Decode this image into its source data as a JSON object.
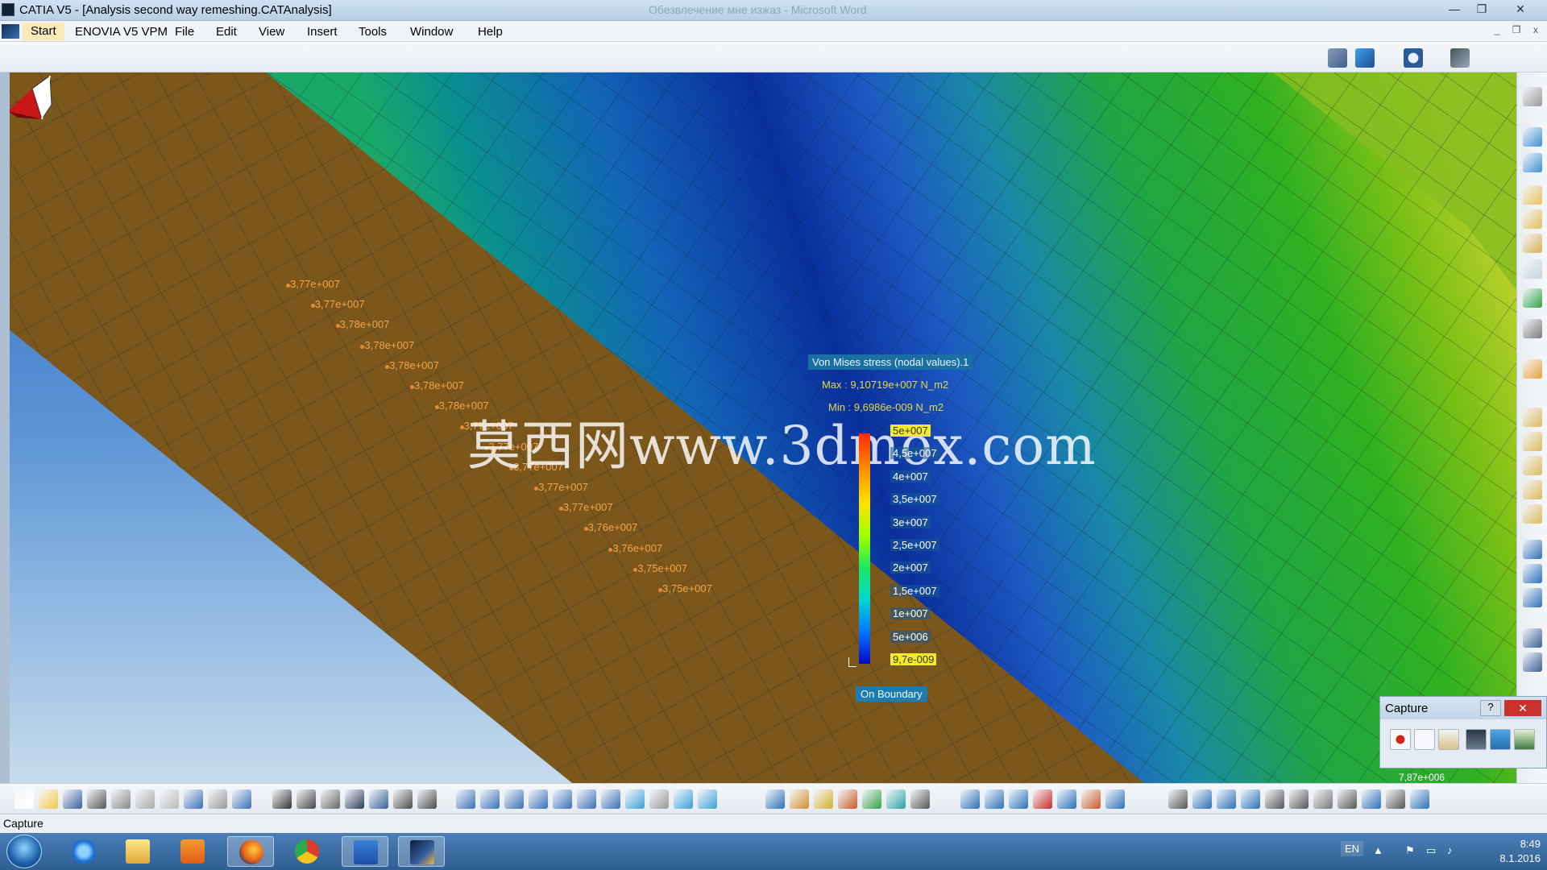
{
  "window": {
    "title": "CATIA V5 - [Analysis second way remeshing.CATAnalysis]",
    "background_title": "Обезвлечение мне изжаз - Microsoft Word",
    "controls": {
      "minimize": "—",
      "restore": "❐",
      "close": "✕"
    }
  },
  "menu": {
    "start": "Start",
    "items": [
      "ENOVIA V5 VPM",
      "File",
      "Edit",
      "View",
      "Insert",
      "Tools",
      "Window",
      "Help"
    ]
  },
  "mdi_controls": {
    "minimize": "_",
    "restore": "❐",
    "close": "x"
  },
  "mesh_labels": [
    "3,77e+007",
    "3,77e+007",
    "3,78e+007",
    "3,78e+007",
    "3,78e+007",
    "3,78e+007",
    "3,78e+007",
    "3,77e+007",
    "3,77e+007",
    "3,77e+007",
    "3,77e+007",
    "3,77e+007",
    "3,76e+007",
    "3,76e+007",
    "3,75e+007",
    "3,75e+007"
  ],
  "legend": {
    "title": "Von Mises stress (nodal values).1",
    "max": "Max : 9,10719e+007 N_m2",
    "min": "Min : 9,6986e-009 N_m2",
    "ticks": [
      "5e+007",
      "4,5e+007",
      "4e+007",
      "3,5e+007",
      "3e+007",
      "2,5e+007",
      "2e+007",
      "1,5e+007",
      "1e+007",
      "5e+006",
      "9,7e-009"
    ],
    "footer": "On Boundary"
  },
  "watermark": "莫西网www.3dmox.com",
  "capture": {
    "title": "Capture",
    "help": "?",
    "close": "✕",
    "coordinate": "7,87e+006"
  },
  "status": {
    "text": "Capture"
  },
  "taskbar": {
    "lang": "EN",
    "time": "8:49",
    "date": "8.1.2016",
    "apps": [
      "internet-explorer",
      "file-explorer",
      "media-player",
      "firefox",
      "chrome",
      "word",
      "catia"
    ]
  },
  "colors": {
    "mesh_band": "#7f5a1c",
    "label": "#f6a347",
    "legend_title_bg": "#1c6fa3",
    "legend_highlight": "#f2ea2c"
  }
}
